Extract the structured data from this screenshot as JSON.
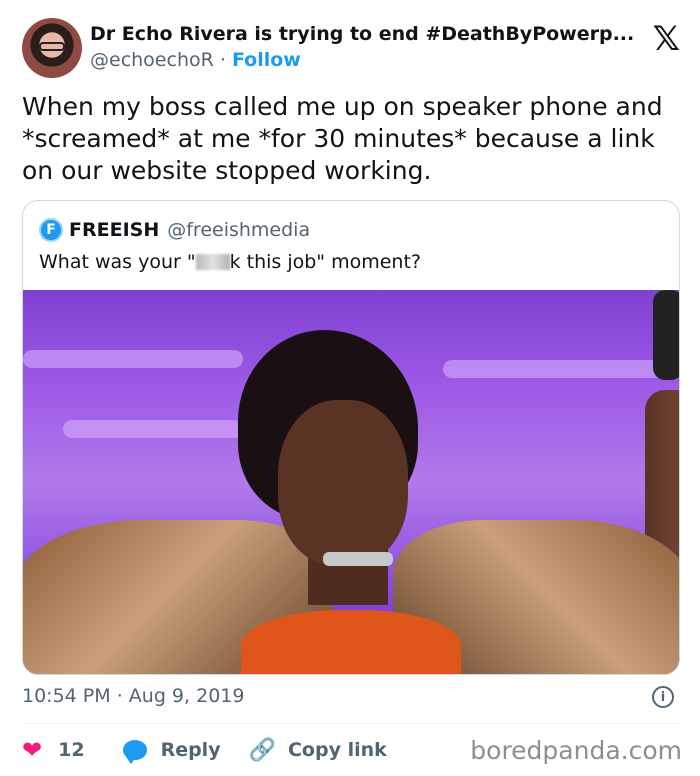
{
  "author": {
    "name": "Dr Echo Rivera is trying to end #DeathByPowerp...",
    "handle": "@echoechoR",
    "separator": "·",
    "follow_label": "Follow",
    "platform_logo": "𝕏"
  },
  "tweet": {
    "text": "When my boss called me up on speaker phone and *screamed* at me *for 30 minutes* because a link on our website stopped working."
  },
  "quoted_tweet": {
    "logo_letter": "F",
    "name": "FREEISH",
    "handle": "@freeishmedia",
    "text_before": "What was your \"",
    "text_after": "k this job\" moment?",
    "image_icon": "photo-woman-raising-arms"
  },
  "meta": {
    "time": "10:54 PM",
    "separator": "·",
    "date": "Aug 9, 2019",
    "info_icon": "i"
  },
  "actions": {
    "like_icon": "❤",
    "like_count": "12",
    "reply_label": "Reply",
    "copy_link_icon": "🔗",
    "copy_link_label": "Copy link"
  },
  "watermark": "boredpanda.com",
  "colors": {
    "accent": "#1d9bf0",
    "like": "#f91880",
    "secondary_text": "#536471"
  }
}
